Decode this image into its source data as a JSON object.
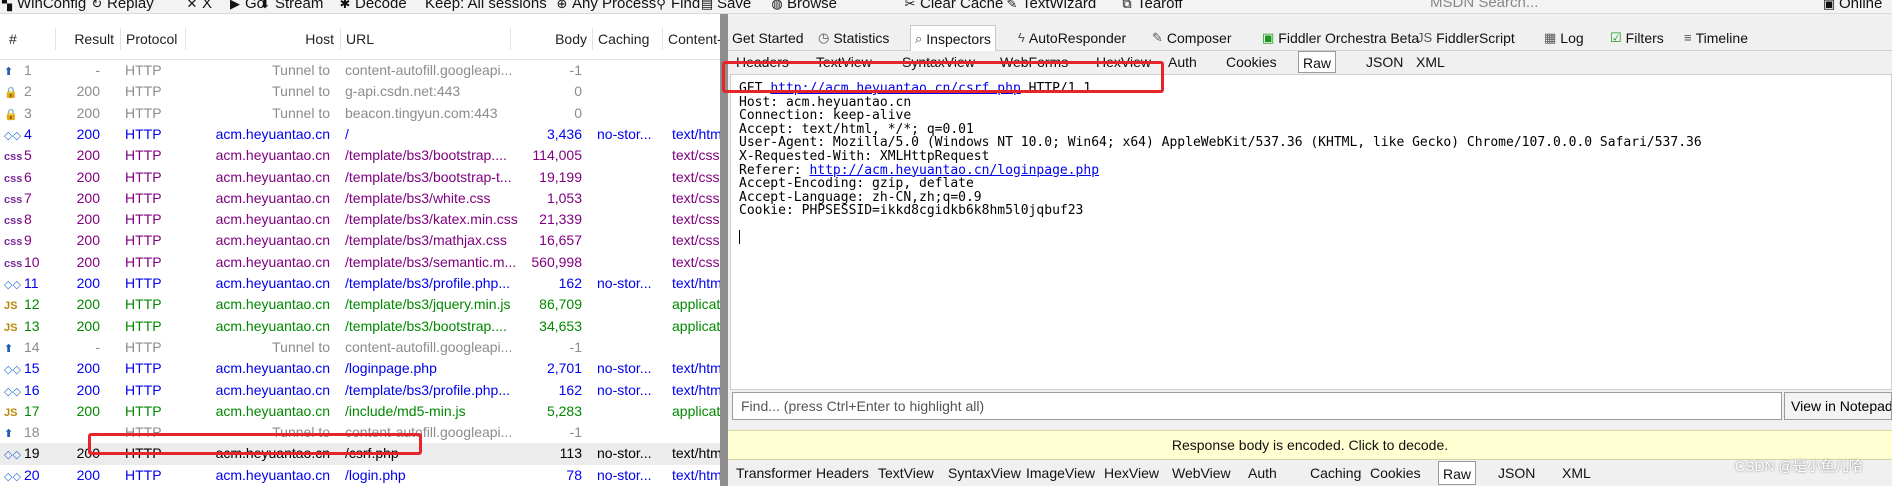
{
  "toolbar": {
    "items": [
      {
        "label": "WinConfig",
        "icon": "windows-icon"
      },
      {
        "label": "Replay",
        "icon": "replay-icon"
      },
      {
        "label": "X",
        "icon": "remove-icon"
      },
      {
        "label": "Go",
        "icon": "play-icon"
      },
      {
        "label": "Stream",
        "icon": "stream-icon"
      },
      {
        "label": "Decode",
        "icon": "decode-icon"
      },
      {
        "label": "Keep: All sessions",
        "icon": ""
      },
      {
        "label": "Any Process",
        "icon": "crosshair-icon"
      },
      {
        "label": "Find",
        "icon": "binoculars-icon"
      },
      {
        "label": "Save",
        "icon": "save-icon"
      },
      {
        "label": "Browse",
        "icon": "browser-icon"
      },
      {
        "label": "Clear Cache",
        "icon": "clear-cache-icon"
      },
      {
        "label": "TextWizard",
        "icon": "text-wizard-icon"
      },
      {
        "label": "Tearoff",
        "icon": "tearoff-icon"
      }
    ],
    "search_placeholder": "MSDN Search...",
    "online_label": "Online"
  },
  "sessions": {
    "columns": [
      "#",
      "Result",
      "Protocol",
      "Host",
      "URL",
      "Body",
      "Caching",
      "Content-"
    ],
    "rows": [
      {
        "num": "1",
        "icon": "upload-arrow-icon",
        "result": "-",
        "protocol": "HTTP",
        "host": "Tunnel to",
        "url": "content-autofill.googleapi...",
        "body": "-1",
        "caching": "",
        "ctype": "",
        "color": "grey"
      },
      {
        "num": "2",
        "icon": "lock-icon",
        "result": "200",
        "protocol": "HTTP",
        "host": "Tunnel to",
        "url": "g-api.csdn.net:443",
        "body": "0",
        "caching": "",
        "ctype": "",
        "color": "grey"
      },
      {
        "num": "3",
        "icon": "lock-icon",
        "result": "200",
        "protocol": "HTTP",
        "host": "Tunnel to",
        "url": "beacon.tingyun.com:443",
        "body": "0",
        "caching": "",
        "ctype": "",
        "color": "grey"
      },
      {
        "num": "4",
        "icon": "html-icon",
        "result": "200",
        "protocol": "HTTP",
        "host": "acm.heyuantao.cn",
        "url": "/",
        "body": "3,436",
        "caching": "no-stor...",
        "ctype": "text/htm",
        "color": "blue"
      },
      {
        "num": "5",
        "icon": "css-icon",
        "result": "200",
        "protocol": "HTTP",
        "host": "acm.heyuantao.cn",
        "url": "/template/bs3/bootstrap....",
        "body": "114,005",
        "caching": "",
        "ctype": "text/css",
        "color": "purple"
      },
      {
        "num": "6",
        "icon": "css-icon",
        "result": "200",
        "protocol": "HTTP",
        "host": "acm.heyuantao.cn",
        "url": "/template/bs3/bootstrap-t...",
        "body": "19,199",
        "caching": "",
        "ctype": "text/css",
        "color": "purple"
      },
      {
        "num": "7",
        "icon": "css-icon",
        "result": "200",
        "protocol": "HTTP",
        "host": "acm.heyuantao.cn",
        "url": "/template/bs3/white.css",
        "body": "1,053",
        "caching": "",
        "ctype": "text/css",
        "color": "purple"
      },
      {
        "num": "8",
        "icon": "css-icon",
        "result": "200",
        "protocol": "HTTP",
        "host": "acm.heyuantao.cn",
        "url": "/template/bs3/katex.min.css",
        "body": "21,339",
        "caching": "",
        "ctype": "text/css",
        "color": "purple"
      },
      {
        "num": "9",
        "icon": "css-icon",
        "result": "200",
        "protocol": "HTTP",
        "host": "acm.heyuantao.cn",
        "url": "/template/bs3/mathjax.css",
        "body": "16,657",
        "caching": "",
        "ctype": "text/css",
        "color": "purple"
      },
      {
        "num": "10",
        "icon": "css-icon",
        "result": "200",
        "protocol": "HTTP",
        "host": "acm.heyuantao.cn",
        "url": "/template/bs3/semantic.m...",
        "body": "560,998",
        "caching": "",
        "ctype": "text/css",
        "color": "purple"
      },
      {
        "num": "11",
        "icon": "html-icon",
        "result": "200",
        "protocol": "HTTP",
        "host": "acm.heyuantao.cn",
        "url": "/template/bs3/profile.php...",
        "body": "162",
        "caching": "no-stor...",
        "ctype": "text/htm",
        "color": "blue"
      },
      {
        "num": "12",
        "icon": "js-icon",
        "result": "200",
        "protocol": "HTTP",
        "host": "acm.heyuantao.cn",
        "url": "/template/bs3/jquery.min.js",
        "body": "86,709",
        "caching": "",
        "ctype": "applicat",
        "color": "green"
      },
      {
        "num": "13",
        "icon": "js-icon",
        "result": "200",
        "protocol": "HTTP",
        "host": "acm.heyuantao.cn",
        "url": "/template/bs3/bootstrap....",
        "body": "34,653",
        "caching": "",
        "ctype": "applicat",
        "color": "green"
      },
      {
        "num": "14",
        "icon": "upload-arrow-icon",
        "result": "-",
        "protocol": "HTTP",
        "host": "Tunnel to",
        "url": "content-autofill.googleapi...",
        "body": "-1",
        "caching": "",
        "ctype": "",
        "color": "grey"
      },
      {
        "num": "15",
        "icon": "html-icon",
        "result": "200",
        "protocol": "HTTP",
        "host": "acm.heyuantao.cn",
        "url": "/loginpage.php",
        "body": "2,701",
        "caching": "no-stor...",
        "ctype": "text/htm",
        "color": "blue"
      },
      {
        "num": "16",
        "icon": "html-icon",
        "result": "200",
        "protocol": "HTTP",
        "host": "acm.heyuantao.cn",
        "url": "/template/bs3/profile.php...",
        "body": "162",
        "caching": "no-stor...",
        "ctype": "text/htm",
        "color": "blue"
      },
      {
        "num": "17",
        "icon": "js-icon",
        "result": "200",
        "protocol": "HTTP",
        "host": "acm.heyuantao.cn",
        "url": "/include/md5-min.js",
        "body": "5,283",
        "caching": "",
        "ctype": "applicat",
        "color": "green"
      },
      {
        "num": "18",
        "icon": "upload-arrow-icon",
        "result": "-",
        "protocol": "HTTP",
        "host": "Tunnel to",
        "url": "content-autofill.googleapi...",
        "body": "-1",
        "caching": "",
        "ctype": "",
        "color": "grey"
      },
      {
        "num": "19",
        "icon": "html-icon",
        "result": "200",
        "protocol": "HTTP",
        "host": "acm.heyuantao.cn",
        "url": "/csrf.php",
        "body": "113",
        "caching": "no-stor...",
        "ctype": "text/htm",
        "color": "dark"
      },
      {
        "num": "20",
        "icon": "html-icon",
        "result": "200",
        "protocol": "HTTP",
        "host": "acm.heyuantao.cn",
        "url": "/login.php",
        "body": "78",
        "caching": "no-stor...",
        "ctype": "text/htm",
        "color": "blue"
      }
    ]
  },
  "inspector": {
    "top_tabs": [
      {
        "label": "Get Started",
        "icon": ""
      },
      {
        "label": "Statistics",
        "icon": "stopwatch-icon"
      },
      {
        "label": "Inspectors",
        "icon": "magnifier-icon"
      },
      {
        "label": "AutoResponder",
        "icon": "lightning-icon"
      },
      {
        "label": "Composer",
        "icon": "composer-icon"
      },
      {
        "label": "Fiddler Orchestra Beta",
        "icon": "fo-icon"
      },
      {
        "label": "FiddlerScript",
        "icon": "js-icon"
      },
      {
        "label": "Log",
        "icon": "log-icon"
      },
      {
        "label": "Filters",
        "icon": "checkbox-icon"
      },
      {
        "label": "Timeline",
        "icon": "timeline-icon"
      }
    ],
    "request_tabs": [
      "Headers",
      "TextView",
      "SyntaxView",
      "WebForms",
      "HexView",
      "Auth",
      "Cookies",
      "Raw",
      "JSON",
      "XML"
    ],
    "request_active": "Raw",
    "request_lines": [
      {
        "pre": "GET ",
        "link": "http://acm.heyuantao.cn/csrf.php",
        "post": " HTTP/1.1"
      },
      {
        "pre": "Host: acm.heyuantao.cn",
        "link": "",
        "post": ""
      },
      {
        "pre": "Connection: keep-alive",
        "link": "",
        "post": ""
      },
      {
        "pre": "Accept: text/html, */*; q=0.01",
        "link": "",
        "post": ""
      },
      {
        "pre": "User-Agent: Mozilla/5.0 (Windows NT 10.0; Win64; x64) AppleWebKit/537.36 (KHTML, like Gecko) Chrome/107.0.0.0 Safari/537.36",
        "link": "",
        "post": ""
      },
      {
        "pre": "X-Requested-With: XMLHttpRequest",
        "link": "",
        "post": ""
      },
      {
        "pre": "Referer: ",
        "link": "http://acm.heyuantao.cn/loginpage.php",
        "post": ""
      },
      {
        "pre": "Accept-Encoding: gzip, deflate",
        "link": "",
        "post": ""
      },
      {
        "pre": "Accept-Language: zh-CN,zh;q=0.9",
        "link": "",
        "post": ""
      },
      {
        "pre": "Cookie: PHPSESSID=ikkd8cgidkb6k8hm5l0jqbuf23",
        "link": "",
        "post": ""
      }
    ],
    "find_placeholder": "Find... (press Ctrl+Enter to highlight all)",
    "view_button": "View in Notepad",
    "response_notice": "Response body is encoded. Click to decode.",
    "response_tabs": [
      "Transformer",
      "Headers",
      "TextView",
      "SyntaxView",
      "ImageView",
      "HexView",
      "WebView",
      "Auth",
      "Caching",
      "Cookies",
      "Raw",
      "JSON",
      "XML"
    ],
    "response_active": "Raw"
  },
  "watermark": "CSDN @是小鱼儿哈",
  "colors": {
    "highlight": "#e5252a",
    "link": "#0000ee",
    "notice_bg": "#ffffd1"
  }
}
